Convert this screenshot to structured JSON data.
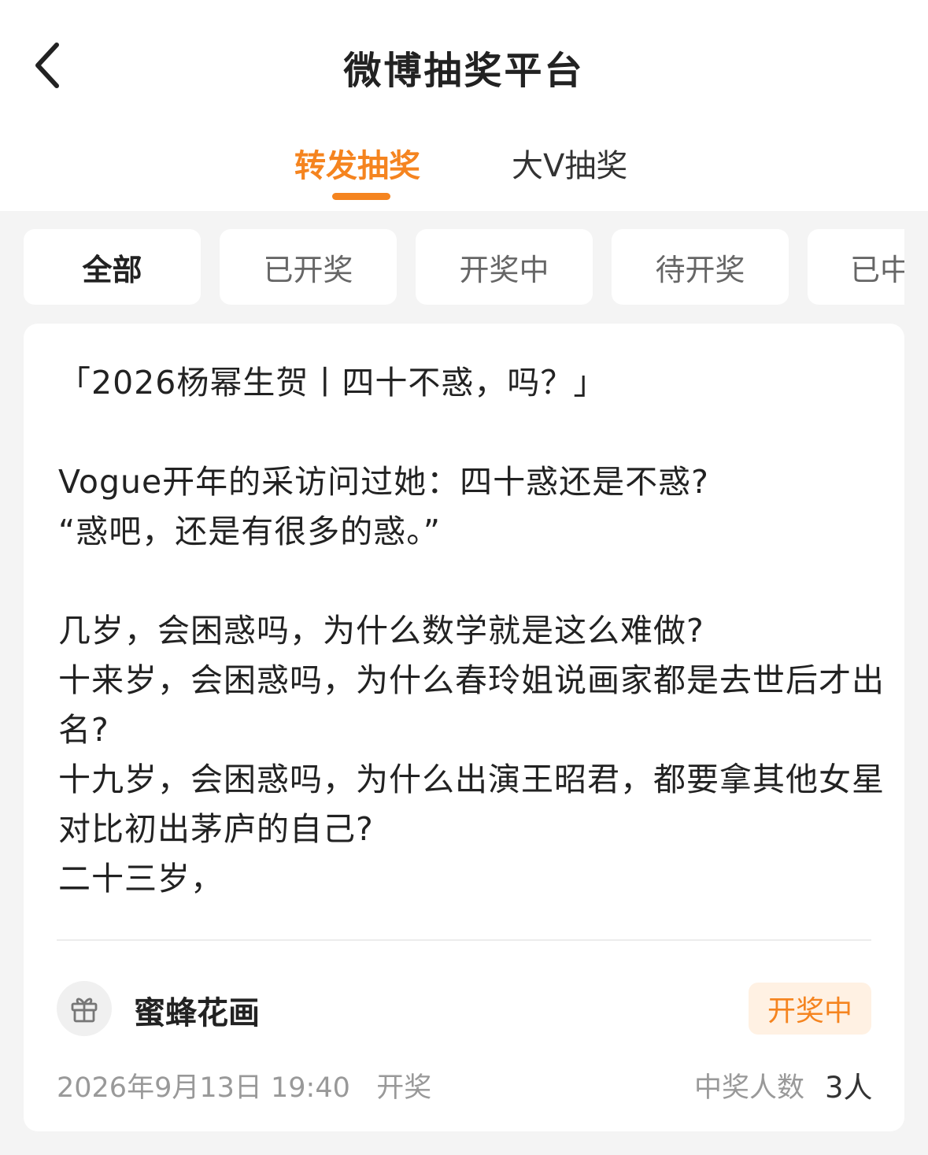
{
  "header": {
    "title": "微博抽奖平台",
    "back_icon": "chevron-left-icon"
  },
  "tabs": [
    {
      "label": "转发抽奖",
      "active": true
    },
    {
      "label": "大V抽奖",
      "active": false
    }
  ],
  "accent_color": "#f5841f",
  "filters": [
    {
      "label": "全部",
      "selected": true
    },
    {
      "label": "已开奖",
      "selected": false
    },
    {
      "label": "开奖中",
      "selected": false
    },
    {
      "label": "待开奖",
      "selected": false
    },
    {
      "label": "已中",
      "selected": false
    }
  ],
  "card": {
    "lines": [
      "「2026杨幂生贺丨四十不惑，吗？」",
      "",
      "Vogue开年的采访问过她：四十惑还是不惑?",
      "“惑吧，还是有很多的惑。”",
      "",
      "几岁，会困惑吗，为什么数学就是这么难做?",
      "十来岁，会困惑吗，为什么春玲姐说画家都是去世后才出名?",
      "十九岁，会困惑吗，为什么出演王昭君，都要拿其他女星对比初出茅庐的自己?",
      "二十三岁，"
    ],
    "sponsor_icon": "gift-icon",
    "sponsor": "蜜蜂花画",
    "status": "开奖中",
    "draw_time": "2026年9月13日 19:40",
    "draw_suffix": "开奖",
    "winners_label": "中奖人数",
    "winners_count": "3人"
  }
}
